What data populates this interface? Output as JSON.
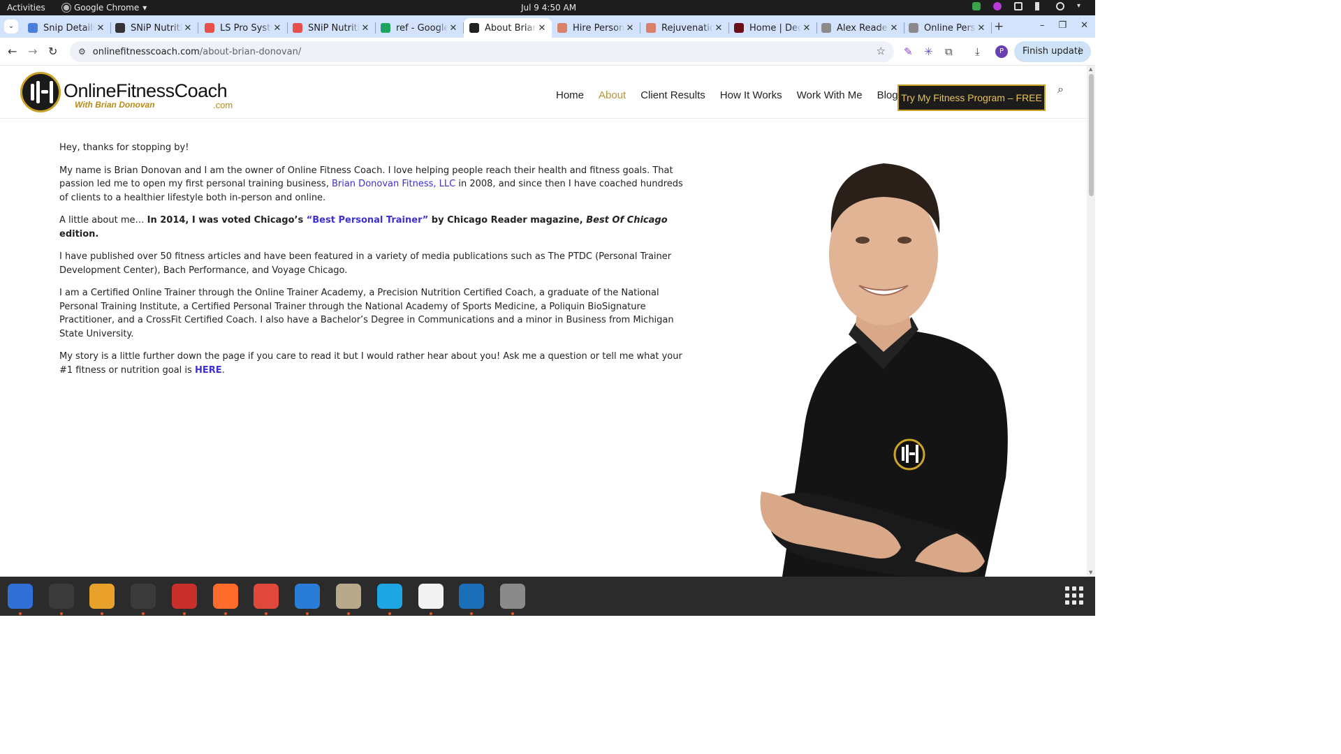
{
  "system_bar": {
    "activities": "Activities",
    "app_name": "Google Chrome",
    "clock": "Jul 9  4:50 AM"
  },
  "tabs": [
    {
      "title": "Snip Details",
      "favicon_color": "#4a7fe0",
      "active": false
    },
    {
      "title": "SNiP Nutrition",
      "favicon_color": "#333333",
      "active": false
    },
    {
      "title": "LS Pro System",
      "favicon_color": "#e5504b",
      "active": false
    },
    {
      "title": "SNiP Nutrition",
      "favicon_color": "#e5504b",
      "active": false
    },
    {
      "title": "ref - Google Sheets",
      "favicon_color": "#1ea362",
      "active": false
    },
    {
      "title": "About Brian Donovan",
      "favicon_color": "#222222",
      "active": true
    },
    {
      "title": "Hire Personal Trainer",
      "favicon_color": "#d97f6a",
      "active": false
    },
    {
      "title": "Rejuvenation",
      "favicon_color": "#d97f6a",
      "active": false
    },
    {
      "title": "Home | Deck",
      "favicon_color": "#6b0f1a",
      "active": false
    },
    {
      "title": "Alex Reader",
      "favicon_color": "#8a8a8a",
      "active": false
    },
    {
      "title": "Online Personal",
      "favicon_color": "#8a8a8a",
      "active": false
    }
  ],
  "address_bar": {
    "host": "onlinefitnesscoach.com",
    "path": "/about-brian-donovan/"
  },
  "toolbar": {
    "profile_initial": "P",
    "finish_update_label": "Finish update"
  },
  "site": {
    "logo": {
      "wordmark": "OnlineFitnessCoach",
      "tagline": "With Brian Donovan",
      "tld": ".com"
    },
    "nav": [
      {
        "label": "Home",
        "current": false
      },
      {
        "label": "About",
        "current": true
      },
      {
        "label": "Client Results",
        "current": false
      },
      {
        "label": "How It Works",
        "current": false
      },
      {
        "label": "Work With Me",
        "current": false
      },
      {
        "label": "Blog",
        "current": false
      }
    ],
    "cta_label": "Try My Fitness Program – FREE",
    "accent_color": "#c9a227",
    "link_color": "#3d2fd0"
  },
  "content": {
    "p1": "Hey, thanks for stopping by!",
    "p2_a": "My name is Brian Donovan and I am the owner of Online Fitness Coach. I love helping people reach their health and fitness goals. That passion led me to open my first personal training business, ",
    "p2_link": "Brian Donovan Fitness, LLC",
    "p2_b": " in 2008, and since then I have coached hundreds of clients to a healthier lifestyle both in-person and online.",
    "p3_a": "A little about me… ",
    "p3_b": "In 2014, I was voted Chicago’s ",
    "p3_link": "“Best Personal Trainer”",
    "p3_c": " by Chicago Reader magazine, ",
    "p3_d": "Best Of Chicago",
    "p3_e": " edition.",
    "p4": "I have published over 50 fitness articles and have been featured in a variety of media publications such as The PTDC (Personal Trainer Development Center), Bach Performance, and Voyage Chicago.",
    "p5": "I am a Certified Online Trainer through the Online Trainer Academy, a Precision Nutrition Certified Coach, a graduate of the National Personal Training Institute, a Certified Personal Trainer through the National Academy of Sports Medicine, a Poliquin BioSignature Practitioner, and a CrossFit Certified Coach. I also have a Bachelor’s Degree in Communications and a minor in Business from Michigan State University.",
    "p6_a": "My story is a little further down the page if you care to read it but I would rather hear about you! Ask me a question or tell me what your #1 fitness or nutrition goal is ",
    "p6_link": "HERE",
    "p6_b": "."
  },
  "dock": [
    {
      "name": "thunderbird-icon",
      "color": "#2f6fd6",
      "running": true
    },
    {
      "name": "terminal-icon",
      "color": "#3a3a3a",
      "running": true
    },
    {
      "name": "calculator-icon",
      "color": "#e8a22c",
      "running": true
    },
    {
      "name": "system-monitor-icon",
      "color": "#3a3a3a",
      "running": true
    },
    {
      "name": "filezilla-icon",
      "color": "#c9302c",
      "running": true
    },
    {
      "name": "firefox-icon",
      "color": "#ff6b2b",
      "running": true
    },
    {
      "name": "chrome-icon",
      "color": "#e0483b",
      "running": true
    },
    {
      "name": "vscode-icon",
      "color": "#2a7dd6",
      "running": true
    },
    {
      "name": "files-icon",
      "color": "#b8a98a",
      "running": true
    },
    {
      "name": "skype-icon",
      "color": "#1ea5e4",
      "running": true
    },
    {
      "name": "text-editor-icon",
      "color": "#f2f2f2",
      "running": true
    },
    {
      "name": "document-viewer-icon",
      "color": "#1b6fb8",
      "running": true
    },
    {
      "name": "disk-icon",
      "color": "#8a8a8a",
      "running": true
    }
  ]
}
